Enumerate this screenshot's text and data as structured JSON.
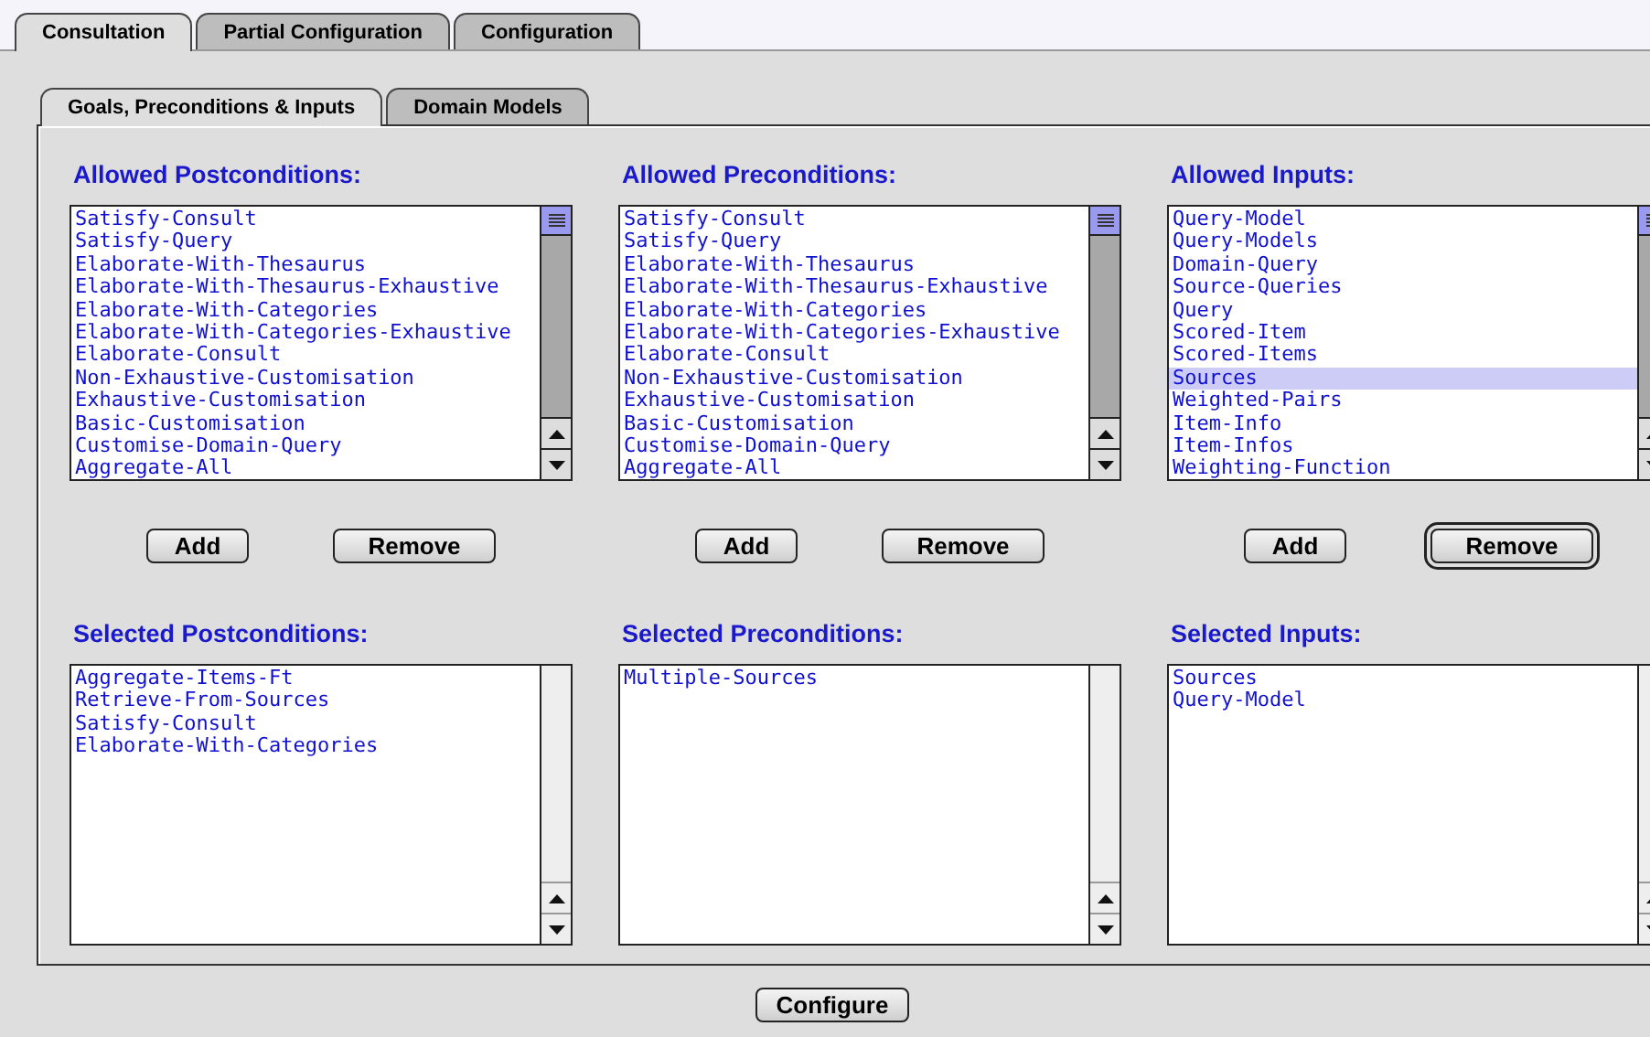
{
  "tabs": [
    {
      "label": "Consultation",
      "selected": true
    },
    {
      "label": "Partial Configuration",
      "selected": false
    },
    {
      "label": "Configuration",
      "selected": false
    }
  ],
  "subtabs": [
    {
      "label": "Goals, Preconditions & Inputs",
      "selected": true
    },
    {
      "label": "Domain Models",
      "selected": false
    }
  ],
  "columns": [
    {
      "allowed_title": "Allowed Postconditions:",
      "allowed_items": [
        {
          "label": "Satisfy-Consult",
          "selected": false
        },
        {
          "label": "Satisfy-Query",
          "selected": false
        },
        {
          "label": "Elaborate-With-Thesaurus",
          "selected": false
        },
        {
          "label": "Elaborate-With-Thesaurus-Exhaustive",
          "selected": false
        },
        {
          "label": "Elaborate-With-Categories",
          "selected": false
        },
        {
          "label": "Elaborate-With-Categories-Exhaustive",
          "selected": false
        },
        {
          "label": "Elaborate-Consult",
          "selected": false
        },
        {
          "label": "Non-Exhaustive-Customisation",
          "selected": false
        },
        {
          "label": "Exhaustive-Customisation",
          "selected": false
        },
        {
          "label": "Basic-Customisation",
          "selected": false
        },
        {
          "label": "Customise-Domain-Query",
          "selected": false
        },
        {
          "label": "Aggregate-All",
          "selected": false
        }
      ],
      "buttons": [
        {
          "label": "Add",
          "default": false
        },
        {
          "label": "Remove",
          "default": false
        }
      ],
      "selected_title": "Selected Postconditions:",
      "selected_items": [
        {
          "label": "Aggregate-Items-Ft",
          "selected": false
        },
        {
          "label": "Retrieve-From-Sources",
          "selected": false
        },
        {
          "label": "Satisfy-Consult",
          "selected": false
        },
        {
          "label": "Elaborate-With-Categories",
          "selected": false
        }
      ]
    },
    {
      "allowed_title": "Allowed Preconditions:",
      "allowed_items": [
        {
          "label": "Satisfy-Consult",
          "selected": false
        },
        {
          "label": "Satisfy-Query",
          "selected": false
        },
        {
          "label": "Elaborate-With-Thesaurus",
          "selected": false
        },
        {
          "label": "Elaborate-With-Thesaurus-Exhaustive",
          "selected": false
        },
        {
          "label": "Elaborate-With-Categories",
          "selected": false
        },
        {
          "label": "Elaborate-With-Categories-Exhaustive",
          "selected": false
        },
        {
          "label": "Elaborate-Consult",
          "selected": false
        },
        {
          "label": "Non-Exhaustive-Customisation",
          "selected": false
        },
        {
          "label": "Exhaustive-Customisation",
          "selected": false
        },
        {
          "label": "Basic-Customisation",
          "selected": false
        },
        {
          "label": "Customise-Domain-Query",
          "selected": false
        },
        {
          "label": "Aggregate-All",
          "selected": false
        }
      ],
      "buttons": [
        {
          "label": "Add",
          "default": false
        },
        {
          "label": "Remove",
          "default": false
        }
      ],
      "selected_title": "Selected Preconditions:",
      "selected_items": [
        {
          "label": "Multiple-Sources",
          "selected": false
        }
      ]
    },
    {
      "allowed_title": "Allowed Inputs:",
      "allowed_items": [
        {
          "label": "Query-Model",
          "selected": false
        },
        {
          "label": "Query-Models",
          "selected": false
        },
        {
          "label": "Domain-Query",
          "selected": false
        },
        {
          "label": "Source-Queries",
          "selected": false
        },
        {
          "label": "Query",
          "selected": false
        },
        {
          "label": "Scored-Item",
          "selected": false
        },
        {
          "label": "Scored-Items",
          "selected": false
        },
        {
          "label": "Sources",
          "selected": true
        },
        {
          "label": "Weighted-Pairs",
          "selected": false
        },
        {
          "label": "Item-Info",
          "selected": false
        },
        {
          "label": "Item-Infos",
          "selected": false
        },
        {
          "label": "Weighting-Function",
          "selected": false
        }
      ],
      "buttons": [
        {
          "label": "Add",
          "default": false
        },
        {
          "label": "Remove",
          "default": true
        }
      ],
      "selected_title": "Selected Inputs:",
      "selected_items": [
        {
          "label": "Sources",
          "selected": false
        },
        {
          "label": "Query-Model",
          "selected": false
        }
      ]
    }
  ],
  "configure_button": {
    "label": "Configure"
  }
}
